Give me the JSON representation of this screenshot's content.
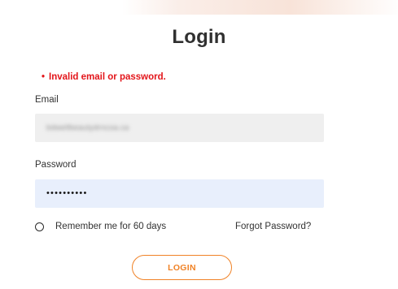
{
  "title": "Login",
  "error": {
    "bullet": "•",
    "message": "Invalid email or password."
  },
  "email": {
    "label": "Email",
    "value": "bdwellbeautydrncoa.ca"
  },
  "password": {
    "label": "Password",
    "masked_value": "••••••••••"
  },
  "remember": {
    "label": "Remember me for 60 days",
    "checked": false
  },
  "forgot_password": "Forgot Password?",
  "login_button": "LOGIN",
  "colors": {
    "error": "#e3151a",
    "accent": "#f08226",
    "email_bg": "#efefef",
    "password_bg": "#e8effc"
  }
}
